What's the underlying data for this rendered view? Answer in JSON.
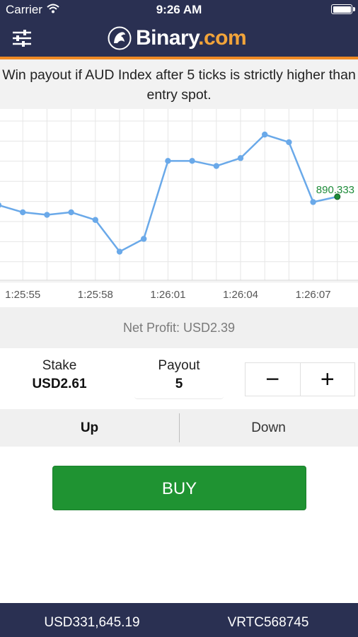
{
  "status_bar": {
    "carrier": "Carrier",
    "time": "9:26 AM"
  },
  "header": {
    "menu_icon": "settings-sliders-icon",
    "brand_name": "Binary",
    "brand_suffix": ".com",
    "accent_color": "#f08a24"
  },
  "contract": {
    "description": "Win payout if AUD Index after 5 ticks is strictly higher than entry spot."
  },
  "chart_data": {
    "type": "line",
    "x": [
      0,
      1,
      2,
      3,
      4,
      5,
      6,
      7,
      8,
      9,
      10,
      11,
      12,
      13,
      14
    ],
    "y": [
      888.24,
      887.96,
      887.86,
      887.96,
      887.66,
      886.42,
      886.92,
      889.97,
      889.97,
      889.77,
      890.08,
      891.0,
      890.7,
      888.36,
      888.57
    ],
    "x_tick_labels": [
      {
        "at": 1,
        "label": "1:25:55"
      },
      {
        "at": 4,
        "label": "1:25:58"
      },
      {
        "at": 7,
        "label": "1:26:01"
      },
      {
        "at": 10,
        "label": "1:26:04"
      },
      {
        "at": 13,
        "label": "1:26:07"
      }
    ],
    "last_value_label": "890.333",
    "ylim": [
      885.3,
      892.0
    ],
    "grid": true,
    "line_color": "#6aa9e9",
    "last_point_color": "#1e8c3a"
  },
  "result": {
    "net_profit": "Net Profit: USD2.39"
  },
  "stake": {
    "label": "Stake",
    "value": "USD2.61"
  },
  "payout": {
    "label": "Payout",
    "value": "5"
  },
  "stepper": {
    "decrement": "−",
    "increment": "+"
  },
  "direction": {
    "up_label": "Up",
    "down_label": "Down",
    "selected": "Up"
  },
  "buy": {
    "label": "BUY",
    "color": "#1f9332"
  },
  "footer": {
    "balance": "USD331,645.19",
    "account_id": "VRTC568745"
  }
}
